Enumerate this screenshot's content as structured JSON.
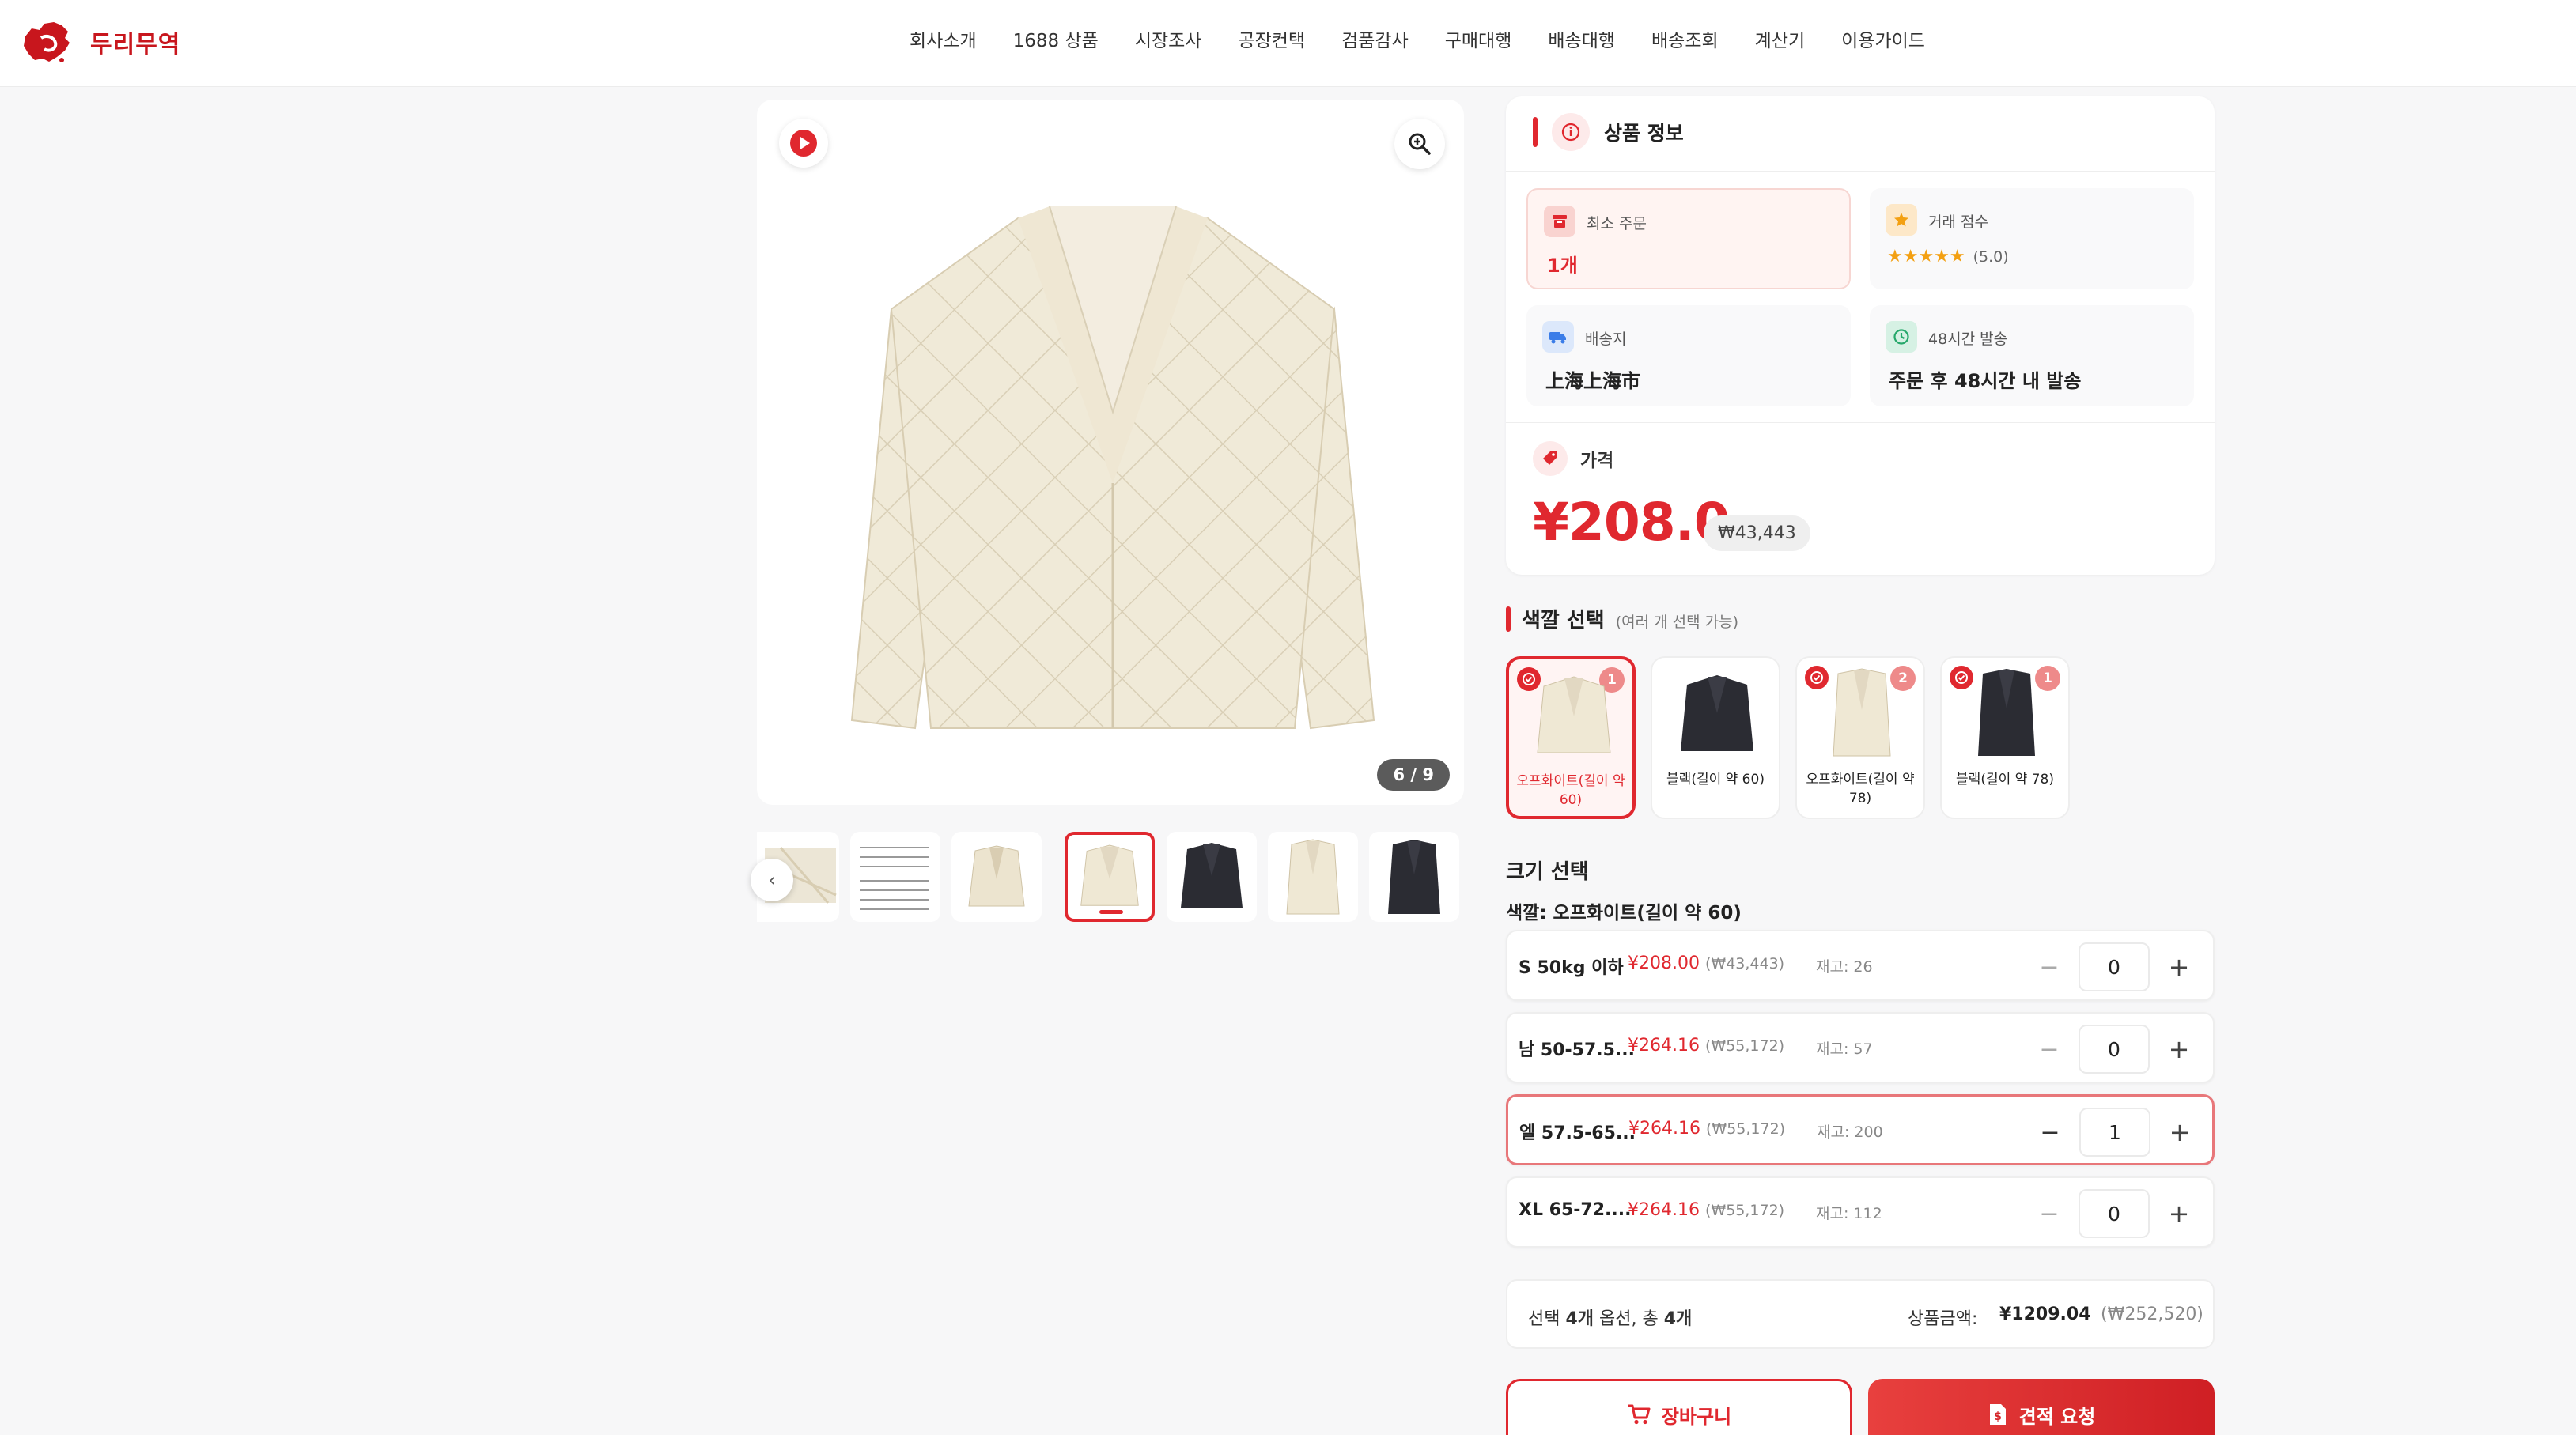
{
  "brand": {
    "name": "두리무역"
  },
  "nav": [
    "회사소개",
    "1688 상품",
    "시장조사",
    "공장컨택",
    "검품감사",
    "구매대행",
    "배송대행",
    "배송조회",
    "계산기",
    "이용가이드"
  ],
  "gallery": {
    "counter": "6 / 9",
    "active_index": 3
  },
  "info": {
    "title": "상품 정보",
    "min_order_label": "최소 주문",
    "min_order_value": "1개",
    "score_label": "거래 점수",
    "score_stars": "★★★★★",
    "score_value": "(5.0)",
    "ship_from_label": "배송지",
    "ship_from_value": "上海上海市",
    "dispatch_label": "48시간 발송",
    "dispatch_value": "주문 후 48시간 내 발송",
    "price_label": "가격",
    "price": "¥208.0",
    "price_krw": "₩43,443"
  },
  "colors": {
    "title": "색깔 선택",
    "subtitle": "(여러 개 선택 가능)",
    "items": [
      {
        "name": "오프화이트(길이 약 60)",
        "badge": "1",
        "selected": true
      },
      {
        "name": "블랙(길이 약 60)",
        "badge": "",
        "selected": false
      },
      {
        "name": "오프화이트(길이 약 78)",
        "badge": "2",
        "selected": false
      },
      {
        "name": "블랙(길이 약 78)",
        "badge": "1",
        "selected": false
      }
    ]
  },
  "sizes": {
    "title": "크기 선택",
    "subtitle": "색깔: 오프화이트(길이 약 60)",
    "rows": [
      {
        "size": "S 50kg 이하",
        "price": "¥208.00",
        "krw": "(₩43,443)",
        "stock": "재고: 26",
        "qty": "0"
      },
      {
        "size": "남 50-57.5...",
        "price": "¥264.16",
        "krw": "(₩55,172)",
        "stock": "재고: 57",
        "qty": "0"
      },
      {
        "size": "엘 57.5-65...",
        "price": "¥264.16",
        "krw": "(₩55,172)",
        "stock": "재고: 200",
        "qty": "1"
      },
      {
        "size": "XL 65-72....",
        "price": "¥264.16",
        "krw": "(₩55,172)",
        "stock": "재고: 112",
        "qty": "0"
      }
    ]
  },
  "summary": {
    "prefix": "선택 ",
    "options": "4개",
    "middle": " 옵션, 총 ",
    "count": "4개",
    "total_label": "상품금액:",
    "total": "¥1209.04",
    "total_krw": "(₩252,520)"
  },
  "buttons": {
    "cart": "장바구니",
    "quote": "견적 요청"
  },
  "colors_theme": {
    "accent": "#e0282f",
    "brand": "#c8161d"
  }
}
